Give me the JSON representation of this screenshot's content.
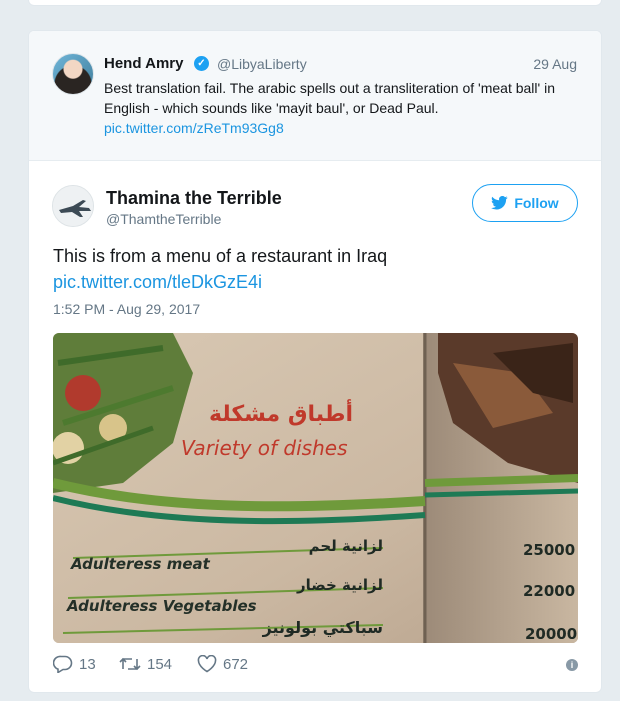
{
  "quoted_tweet": {
    "name": "Hend Amry",
    "handle": "@LibyaLiberty",
    "date": "29 Aug",
    "text": "Best translation fail. The arabic spells out a transliteration of 'meat ball' in English - which sounds like 'mayit baul', or Dead Paul.",
    "link": "pic.twitter.com/zReTm93Gg8",
    "verified_icon": "verified-check-icon"
  },
  "tweet": {
    "name": "Thamina the Terrible",
    "handle": "@ThamtheTerrible",
    "follow_label": "Follow",
    "text": "This is from a menu of a restaurant in Iraq",
    "link": "pic.twitter.com/tleDkGzE4i",
    "timestamp": "1:52 PM - Aug 29, 2017"
  },
  "media": {
    "arabic_heading": "أطباق مشكلة",
    "heading": "Variety of dishes",
    "items": [
      {
        "arabic": "لزانية لحم",
        "english": "Adulteress meat",
        "price": "25000"
      },
      {
        "arabic": "لزانية خضار",
        "english": "Adulteress Vegetables",
        "price": "22000"
      },
      {
        "arabic": "سباكتي بولونيز",
        "english": "",
        "price": "20000"
      }
    ]
  },
  "stats": {
    "replies": "13",
    "retweets": "154",
    "likes": "672"
  },
  "colors": {
    "accent": "#1da1f2",
    "link": "#1b95e0",
    "muted": "#657786",
    "background": "#e6ecf0"
  }
}
